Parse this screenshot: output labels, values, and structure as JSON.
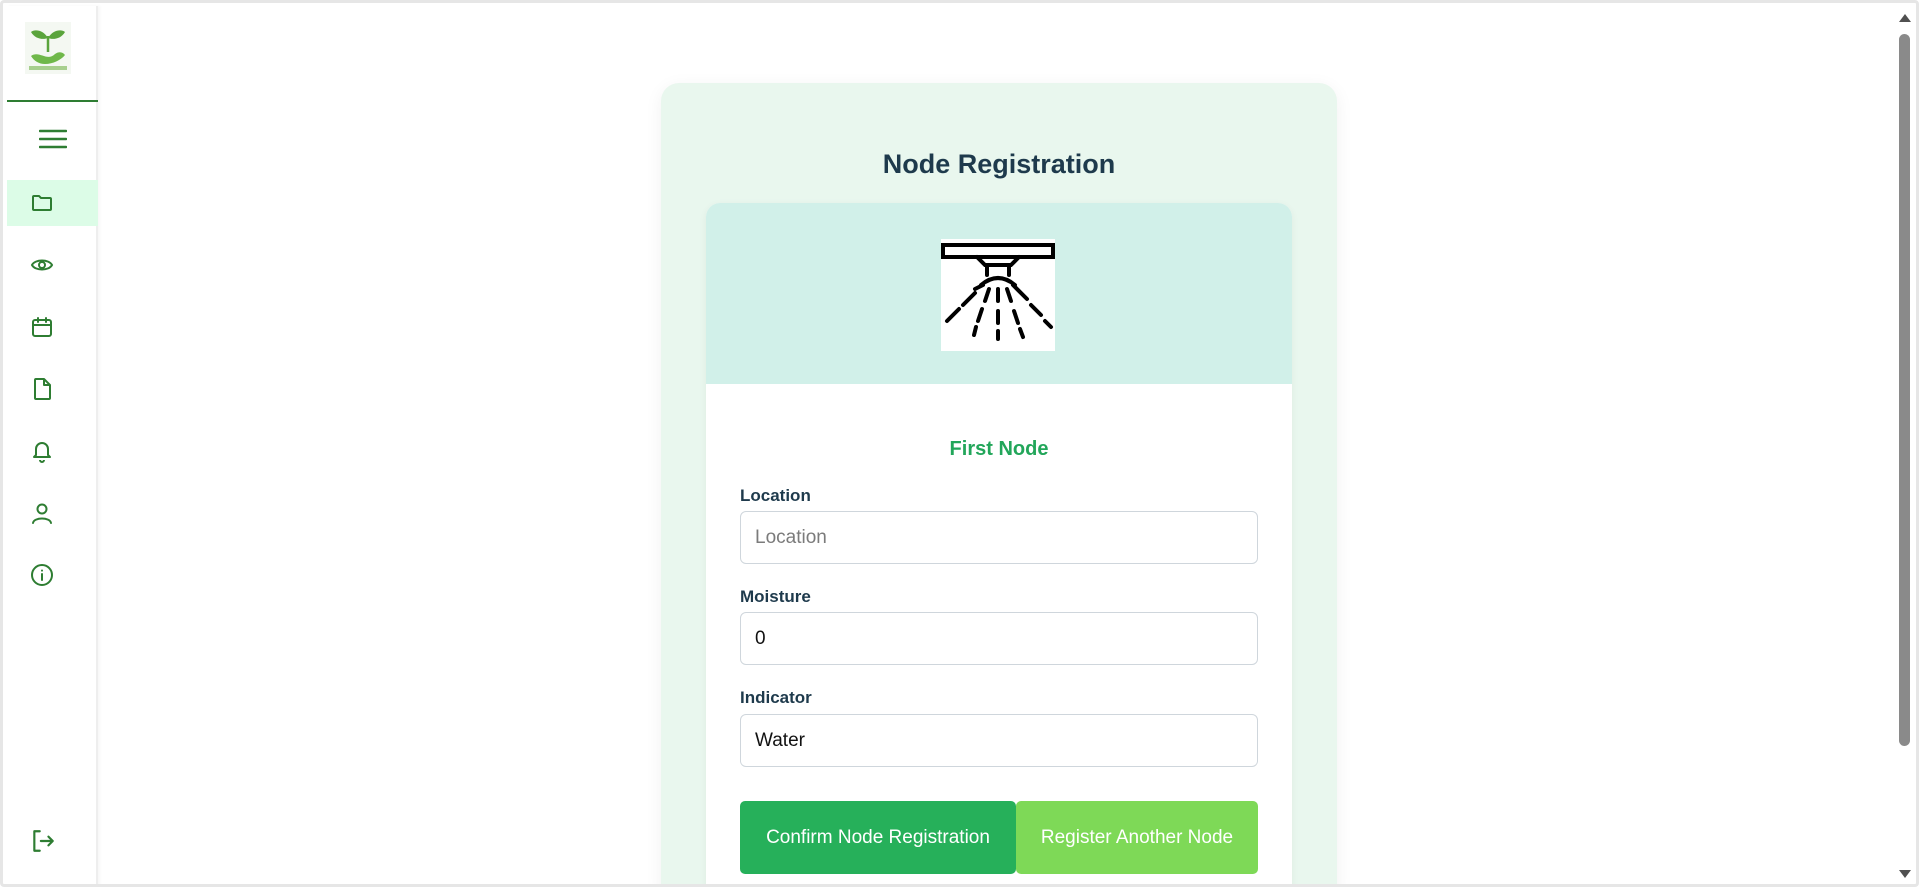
{
  "colors": {
    "brand_green": "#2e7d32",
    "accent_green": "#26b05a",
    "light_green": "#7ed957",
    "title_dark": "#1e3a4c"
  },
  "sidebar": {
    "items": [
      {
        "icon": "menu-icon"
      },
      {
        "icon": "folder-icon",
        "active": true
      },
      {
        "icon": "eye-icon"
      },
      {
        "icon": "calendar-icon"
      },
      {
        "icon": "file-icon"
      },
      {
        "icon": "bell-icon"
      },
      {
        "icon": "user-icon"
      },
      {
        "icon": "info-icon"
      },
      {
        "icon": "logout-icon"
      }
    ]
  },
  "main": {
    "title": "Node Registration",
    "node_title": "First Node",
    "fields": {
      "location": {
        "label": "Location",
        "placeholder": "Location",
        "value": ""
      },
      "moisture": {
        "label": "Moisture",
        "value": "0"
      },
      "indicator": {
        "label": "Indicator",
        "value": "Water"
      }
    },
    "buttons": {
      "confirm": "Confirm Node Registration",
      "register_another": "Register Another Node"
    }
  }
}
